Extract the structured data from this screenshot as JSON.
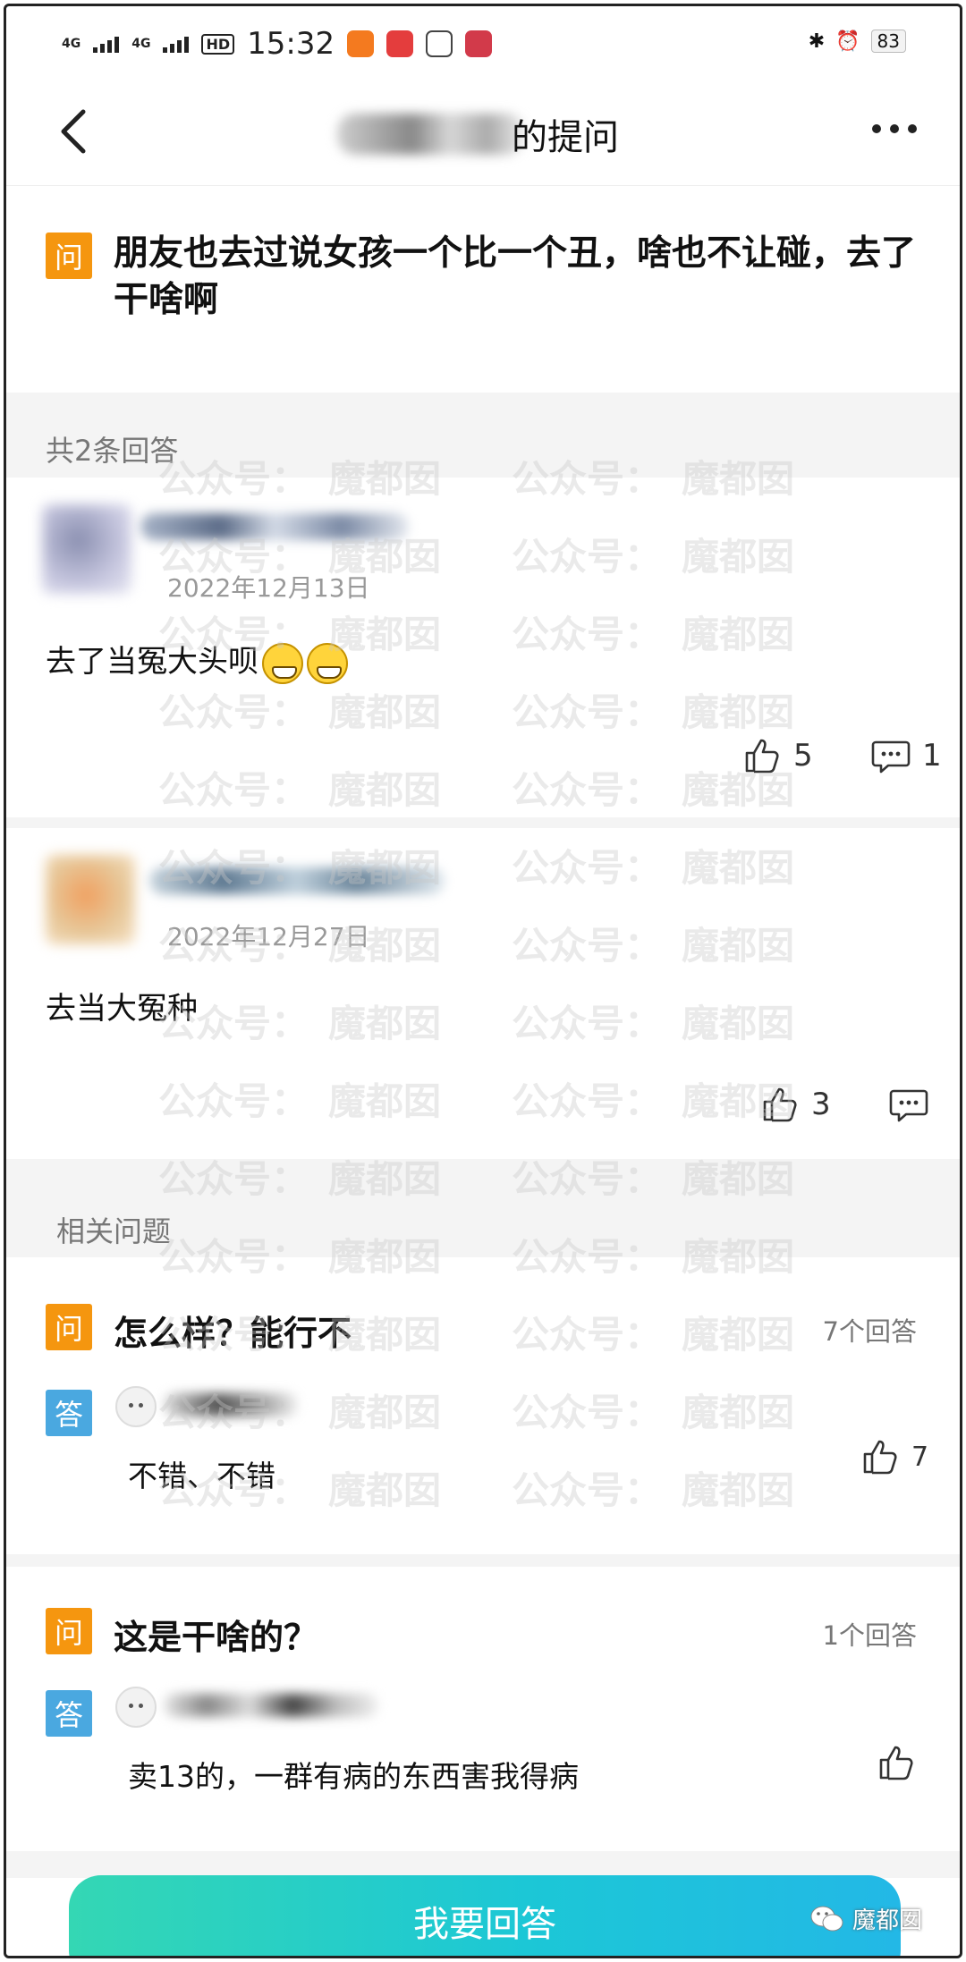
{
  "status_bar": {
    "network_1": "4G",
    "network_2": "4G",
    "hd": "HD",
    "time": "15:32",
    "battery": "83"
  },
  "header": {
    "title_suffix": "的提问",
    "back_icon": "chevron-left-icon",
    "more_icon": "more-dots-icon"
  },
  "question": {
    "tag": "问",
    "text": "朋友也去过说女孩一个比一个丑，啥也不让碰，去了干啥啊"
  },
  "answers_section": {
    "label": "共2条回答"
  },
  "answers": [
    {
      "date": "2022年12月13日",
      "text": "去了当冤大头呗",
      "likes": "5",
      "comments": "1"
    },
    {
      "date": "2022年12月27日",
      "text": "去当大冤种",
      "likes": "3",
      "comments": ""
    }
  ],
  "related_section": {
    "label": "相关问题"
  },
  "related": [
    {
      "q_tag": "问",
      "question": "怎么样？能行不",
      "count": "7个回答",
      "a_tag": "答",
      "answer": "不错、不错",
      "likes": "7"
    },
    {
      "q_tag": "问",
      "question": "这是干啥的？",
      "count": "1个回答",
      "a_tag": "答",
      "answer": "卖13的，一群有病的东西害我得病",
      "likes": ""
    }
  ],
  "bottom": {
    "answer_button": "我要回答",
    "brand": "魔都囡"
  },
  "watermark": {
    "text_1": "公众号：",
    "text_2": "魔都囡"
  },
  "colors": {
    "question_tag": "#f5960f",
    "answer_tag": "#4aa8e0",
    "button_gradient_start": "#34d7b4",
    "button_gradient_end": "#23b8e6"
  }
}
